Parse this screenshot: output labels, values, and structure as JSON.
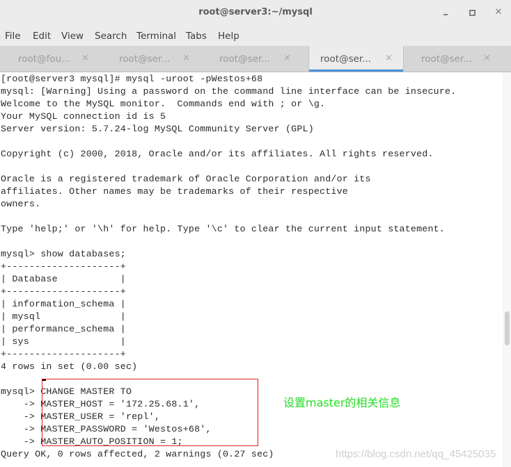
{
  "window": {
    "title": "root@server3:~/mysql",
    "controls": {
      "minimize": "_",
      "maximize": "□",
      "close": "✕"
    }
  },
  "menu": [
    "File",
    "Edit",
    "View",
    "Search",
    "Terminal",
    "Tabs",
    "Help"
  ],
  "tabs": [
    {
      "label": "root@fou...",
      "close": "×",
      "active": false
    },
    {
      "label": "root@ser...",
      "close": "×",
      "active": false
    },
    {
      "label": "root@ser...",
      "close": "×",
      "active": false
    },
    {
      "label": "root@ser...",
      "close": "×",
      "active": true
    },
    {
      "label": "root@ser...",
      "close": "×",
      "active": false
    }
  ],
  "terminal": {
    "lines": [
      "[root@server3 mysql]# mysql -uroot -pWestos+68",
      "mysql: [Warning] Using a password on the command line interface can be insecure.",
      "Welcome to the MySQL monitor.  Commands end with ; or \\g.",
      "Your MySQL connection id is 5",
      "Server version: 5.7.24-log MySQL Community Server (GPL)",
      "",
      "Copyright (c) 2000, 2018, Oracle and/or its affiliates. All rights reserved.",
      "",
      "Oracle is a registered trademark of Oracle Corporation and/or its",
      "affiliates. Other names may be trademarks of their respective",
      "owners.",
      "",
      "Type 'help;' or '\\h' for help. Type '\\c' to clear the current input statement.",
      "",
      "mysql> show databases;",
      "+--------------------+",
      "| Database           |",
      "+--------------------+",
      "| information_schema |",
      "| mysql              |",
      "| performance_schema |",
      "| sys                |",
      "+--------------------+",
      "4 rows in set (0.00 sec)",
      "",
      "mysql> CHANGE MASTER TO",
      "    -> MASTER_HOST = '172.25.68.1',",
      "    -> MASTER_USER = 'repl',",
      "    -> MASTER_PASSWORD = 'Westos+68',",
      "    -> MASTER_AUTO_POSITION = 1;",
      "Query OK, 0 rows affected, 2 warnings (0.27 sec)"
    ]
  },
  "annotation": "设置master的相关信息",
  "watermark": "https://blog.csdn.net/qq_45425035",
  "colors": {
    "annotation": "#22dd22",
    "highlight_box": "#e02020",
    "active_tab_indicator": "#4a90d9"
  }
}
